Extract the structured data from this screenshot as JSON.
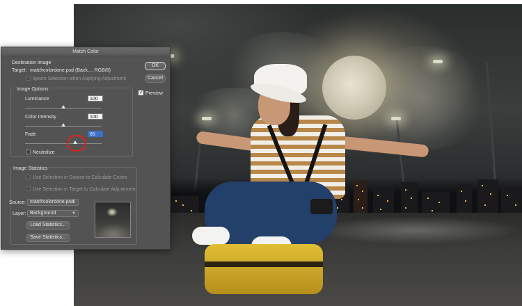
{
  "dialog": {
    "title": "Match Color",
    "destination": {
      "group_label": "Destination Image",
      "target_label": "Target:",
      "target_value": "matchcolordone.psd (Back..., RGB/8)",
      "ignore_selection_label": "Ignore Selection when Applying Adjustment"
    },
    "image_options": {
      "group_label": "Image Options",
      "luminance_label": "Luminance",
      "luminance_value": "100",
      "color_intensity_label": "Color Intensity",
      "color_intensity_value": "100",
      "fade_label": "Fade",
      "fade_value": "65",
      "neutralize_label": "Neutralize",
      "luminance_level": 0.5,
      "color_intensity_level": 0.5,
      "fade_level": 0.65
    },
    "image_statistics": {
      "group_label": "Image Statistics",
      "use_source_label": "Use Selection in Source to Calculate Colors",
      "use_target_label": "Use Selection in Target to Calculate Adjustment",
      "source_label": "Source:",
      "source_value": "matchcolordone.psd",
      "layer_label": "Layer:",
      "layer_value": "Background",
      "load_button": "Load Statistics...",
      "save_button": "Save Statistics..."
    },
    "buttons": {
      "ok": "OK",
      "cancel": "Cancel",
      "preview_label": "Preview"
    }
  },
  "colors": {
    "dialog_bg": "#535353",
    "selection_blue": "#3b6fc9",
    "annotation_red": "#e0201c"
  },
  "icons": {
    "dropdown": "chevron-down-icon",
    "check": "checkmark-icon"
  }
}
